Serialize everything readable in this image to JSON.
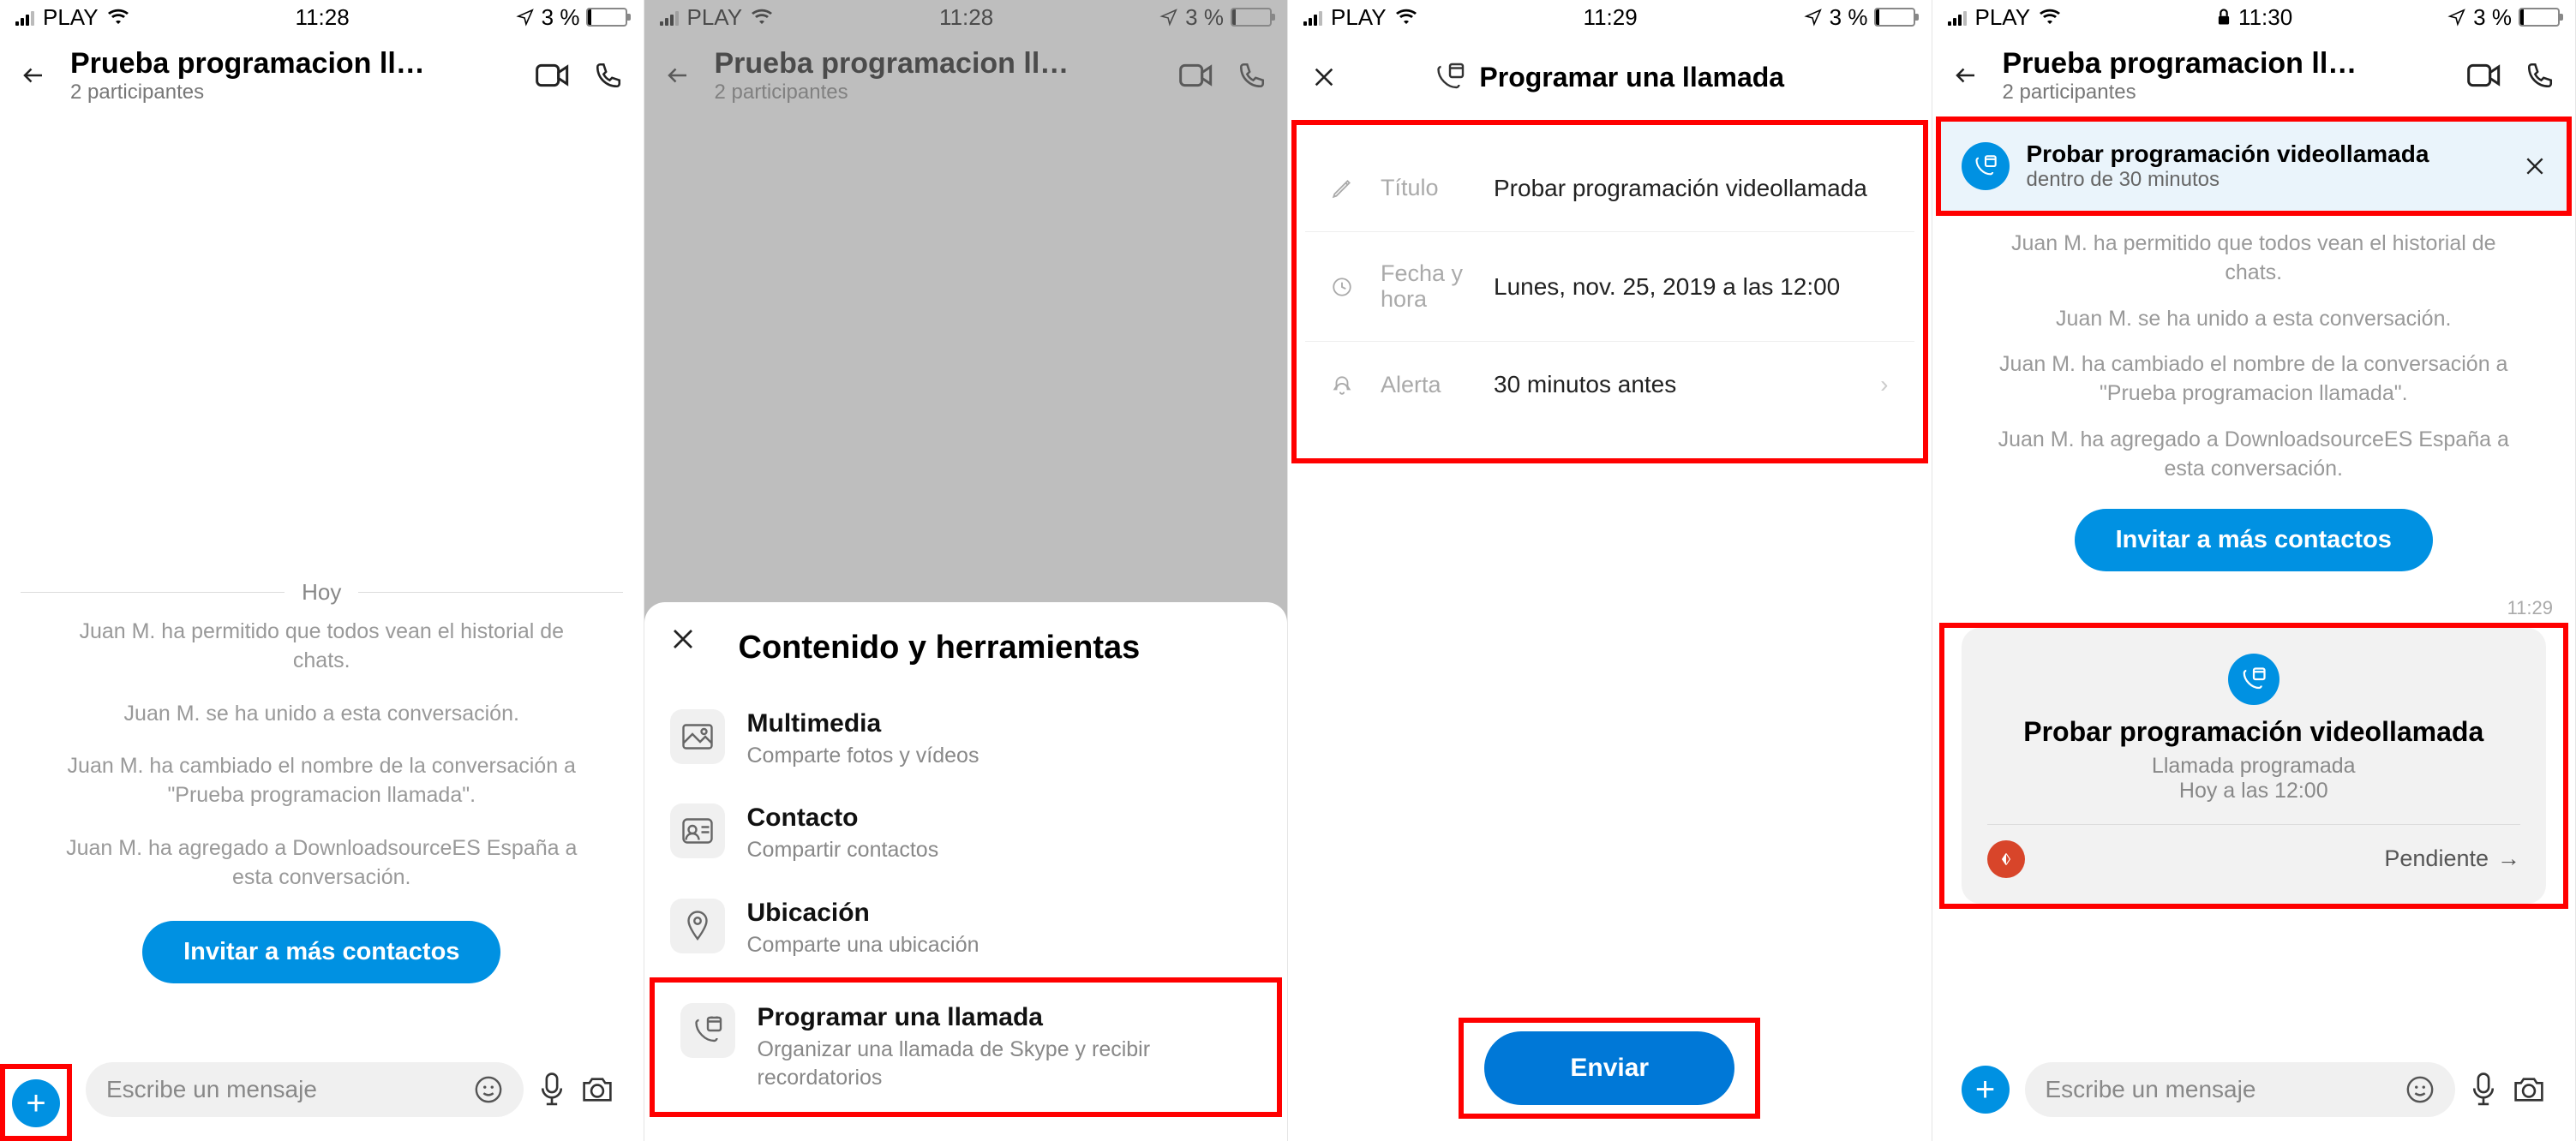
{
  "status": {
    "carrier": "PLAY",
    "time1": "11:28",
    "time2": "11:28",
    "time3": "11:29",
    "time4": "11:30",
    "battery": "3 %"
  },
  "chat": {
    "title": "Prueba programacion ll…",
    "subtitle": "2 participantes"
  },
  "today_label": "Hoy",
  "system_messages": {
    "m1": "Juan M. ha permitido que todos vean el historial de chats.",
    "m2": "Juan M. se ha unido a esta conversación.",
    "m3": "Juan M. ha cambiado el nombre de la conversación a \"Prueba programacion llamada\".",
    "m4": "Juan M. ha agregado a DownloadsourceES España a esta conversación."
  },
  "invite_label": "Invitar a más contactos",
  "input_placeholder": "Escribe un mensaje",
  "sheet": {
    "title": "Contenido y herramientas",
    "items": [
      {
        "title": "Multimedia",
        "sub": "Comparte fotos y vídeos"
      },
      {
        "title": "Contacto",
        "sub": "Compartir contactos"
      },
      {
        "title": "Ubicación",
        "sub": "Comparte una ubicación"
      },
      {
        "title": "Programar una llamada",
        "sub": "Organizar una llamada de Skype y recibir recordatorios"
      }
    ]
  },
  "schedule": {
    "header": "Programar una llamada",
    "title_label": "Título",
    "title_value": "Probar programación videollamada",
    "date_label": "Fecha y hora",
    "date_value": "Lunes, nov. 25, 2019 a las 12:00",
    "alert_label": "Alerta",
    "alert_value": "30 minutos antes",
    "send": "Enviar"
  },
  "banner": {
    "title": "Probar programación videollamada",
    "sub": "dentro de 30 minutos"
  },
  "card": {
    "title": "Probar programación videollamada",
    "sub": "Llamada programada",
    "time": "Hoy a las 12:00",
    "status": "Pendiente",
    "timestamp": "11:29"
  }
}
